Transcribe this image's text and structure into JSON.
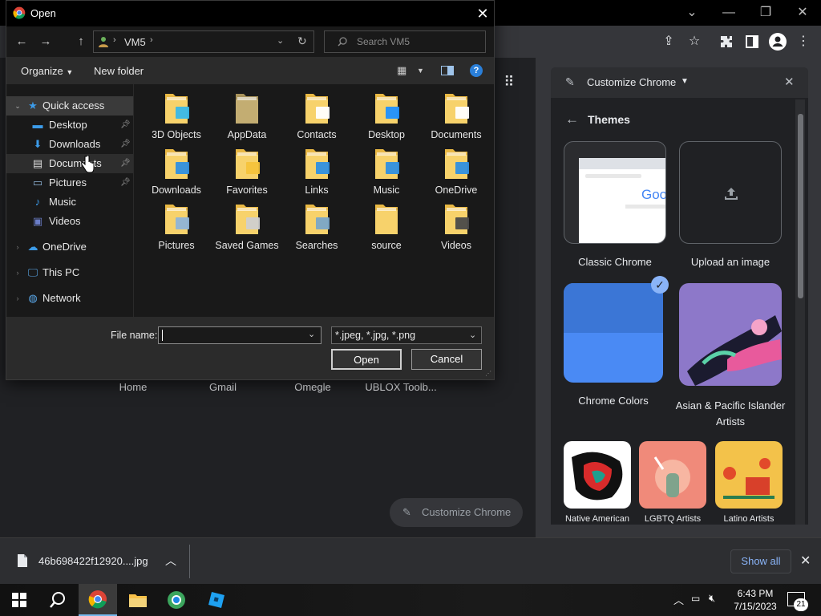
{
  "dialog": {
    "title": "Open",
    "address_path": "VM5",
    "search_placeholder": "Search VM5",
    "organize_label": "Organize",
    "new_folder_label": "New folder",
    "nav": {
      "quick_access": "Quick access",
      "desktop": "Desktop",
      "downloads": "Downloads",
      "documents": "Documents",
      "pictures": "Pictures",
      "music": "Music",
      "videos": "Videos",
      "onedrive": "OneDrive",
      "this_pc": "This PC",
      "network": "Network"
    },
    "files": [
      {
        "name": "3D Objects",
        "overlay": "#39b8e8"
      },
      {
        "name": "AppData",
        "overlay": ""
      },
      {
        "name": "Contacts",
        "overlay": "#ffffff"
      },
      {
        "name": "Desktop",
        "overlay": "#1e90ff"
      },
      {
        "name": "Documents",
        "overlay": "#ffffff"
      },
      {
        "name": "Downloads",
        "overlay": "#2f8fe0"
      },
      {
        "name": "Favorites",
        "overlay": "#f5c33b"
      },
      {
        "name": "Links",
        "overlay": "#2f8fe0"
      },
      {
        "name": "Music",
        "overlay": "#2f8fe0"
      },
      {
        "name": "OneDrive",
        "overlay": "#2f8fe0"
      },
      {
        "name": "Pictures",
        "overlay": "#8fb4d8"
      },
      {
        "name": "Saved Games",
        "overlay": "#cfcfcf"
      },
      {
        "name": "Searches",
        "overlay": "#7aa6c8"
      },
      {
        "name": "source",
        "overlay": ""
      },
      {
        "name": "Videos",
        "overlay": "#4a4a4a"
      }
    ],
    "file_name_label": "File name:",
    "file_name_value": "",
    "file_type_filter": "*.jpeg, *.jpg, *.png",
    "open_label": "Open",
    "cancel_label": "Cancel"
  },
  "chrome": {
    "shortcuts": [
      "Home",
      "Gmail",
      "Omegle",
      "UBLOX Toolb..."
    ],
    "customize_button": "Customize Chrome",
    "side_panel": {
      "title": "Customize Chrome",
      "section": "Themes",
      "themes": [
        {
          "label": "Classic Chrome"
        },
        {
          "label": "Upload an image"
        },
        {
          "label": "Chrome Colors"
        },
        {
          "label": "Asian & Pacific Islander Artists"
        },
        {
          "label": "Native American"
        },
        {
          "label": "LGBTQ Artists"
        },
        {
          "label": "Latino Artists"
        }
      ],
      "classic_preview_text": "Goo"
    }
  },
  "download_bar": {
    "file_name": "46b698422f12920....jpg",
    "show_all": "Show all"
  },
  "taskbar": {
    "time": "6:43 PM",
    "date": "7/15/2023",
    "notification_count": "21"
  }
}
